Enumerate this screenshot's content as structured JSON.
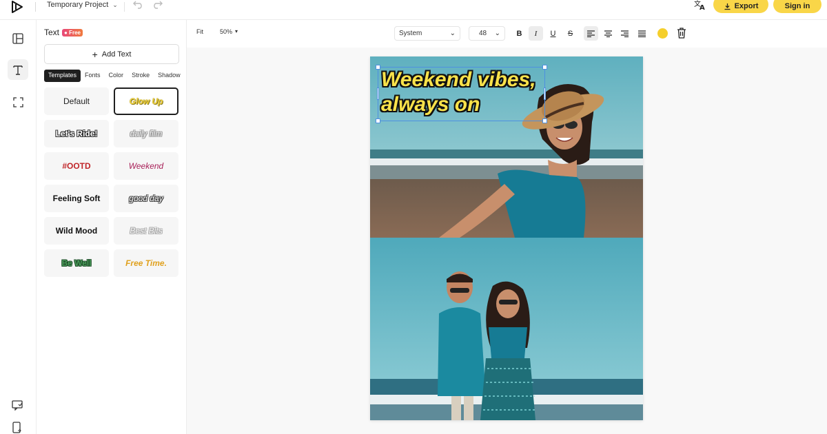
{
  "header": {
    "project_name": "Temporary Project",
    "export_label": "Export",
    "signin_label": "Sign in",
    "icons": [
      "logo-icon",
      "chevron-down-icon",
      "undo-icon",
      "redo-icon",
      "translate-icon",
      "download-icon"
    ]
  },
  "rail": {
    "items": [
      {
        "name": "layout-icon",
        "active": false
      },
      {
        "name": "text-icon",
        "active": true
      },
      {
        "name": "resize-icon",
        "active": false
      }
    ],
    "bottom": [
      "feedback-icon",
      "mobile-icon"
    ]
  },
  "panel": {
    "title": "Text",
    "badge": "Free",
    "add_text_label": "Add Text",
    "tabs": [
      "Templates",
      "Fonts",
      "Color",
      "Stroke",
      "Shadow"
    ],
    "active_tab": "Templates",
    "templates": [
      {
        "label": "Default",
        "style": "default"
      },
      {
        "label": "Glow Up",
        "style": "glow"
      },
      {
        "label": "Let's Ride!",
        "style": "ride"
      },
      {
        "label": "daily film",
        "style": "daily"
      },
      {
        "label": "#OOTD",
        "style": "ootd"
      },
      {
        "label": "Weekend",
        "style": "weekend"
      },
      {
        "label": "Feeling Soft",
        "style": "soft"
      },
      {
        "label": "good day",
        "style": "goodday"
      },
      {
        "label": "Wild Mood",
        "style": "wild"
      },
      {
        "label": "Best Bits",
        "style": "bestbits"
      },
      {
        "label": "Be Well",
        "style": "bewell"
      },
      {
        "label": "Free Time.",
        "style": "freetime"
      }
    ],
    "selected_template": "Glow Up"
  },
  "toolbar": {
    "fit_label": "Fit",
    "zoom": "50%",
    "font_family": "System",
    "font_size": "48",
    "text_color": "#f5cf2c",
    "bold": "B",
    "italic": "I",
    "underline": "U",
    "strike": "S",
    "italic_active": true,
    "align_left_active": true
  },
  "canvas": {
    "headline": "Weekend vibes,\nalways on"
  }
}
